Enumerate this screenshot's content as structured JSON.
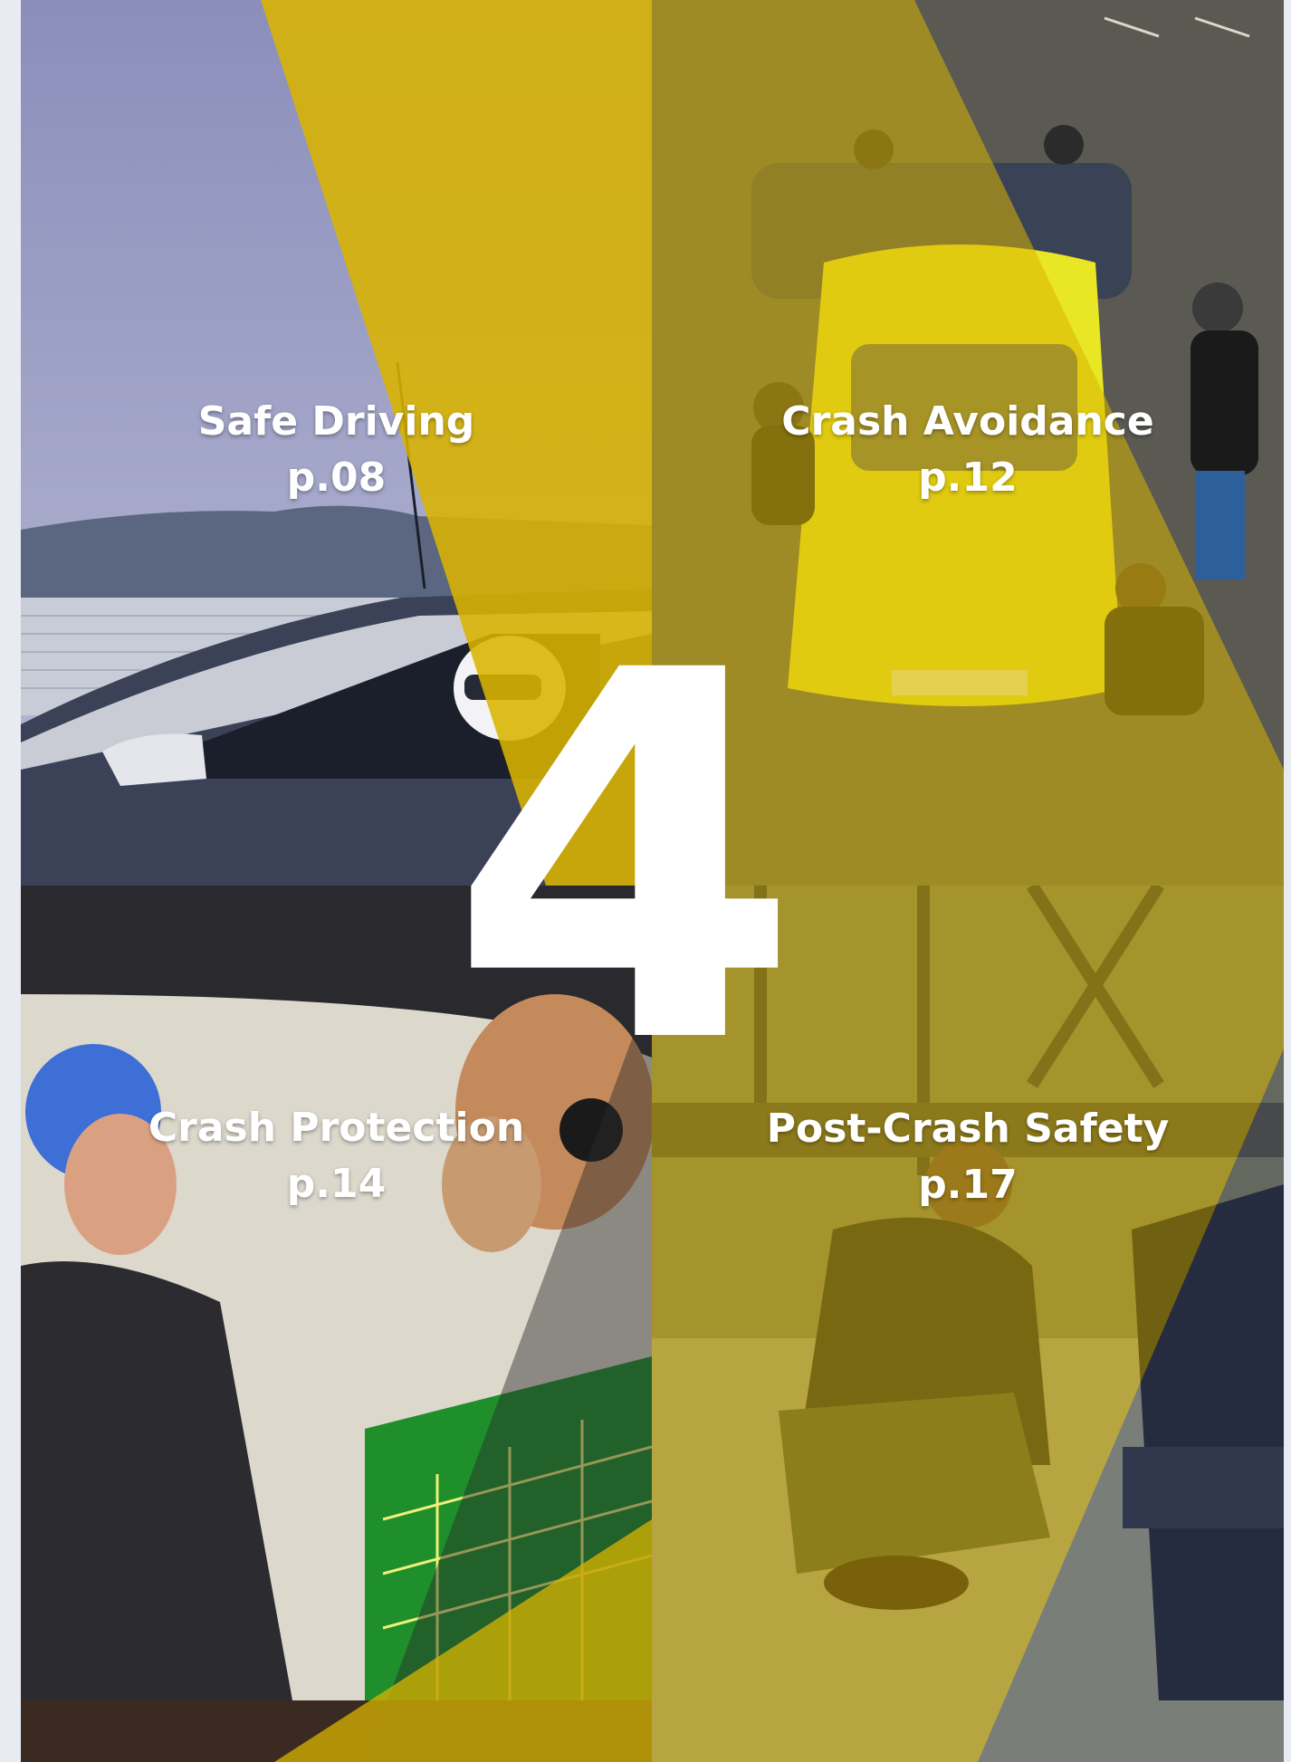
{
  "sections": [
    {
      "title": "Safe Driving",
      "page": "p.08"
    },
    {
      "title": "Crash Avoidance",
      "page": "p.12"
    },
    {
      "title": "Crash Protection",
      "page": "p.14"
    },
    {
      "title": "Post-Crash Safety",
      "page": "p.17"
    }
  ],
  "big_number": "4",
  "accent": "#d9b400"
}
